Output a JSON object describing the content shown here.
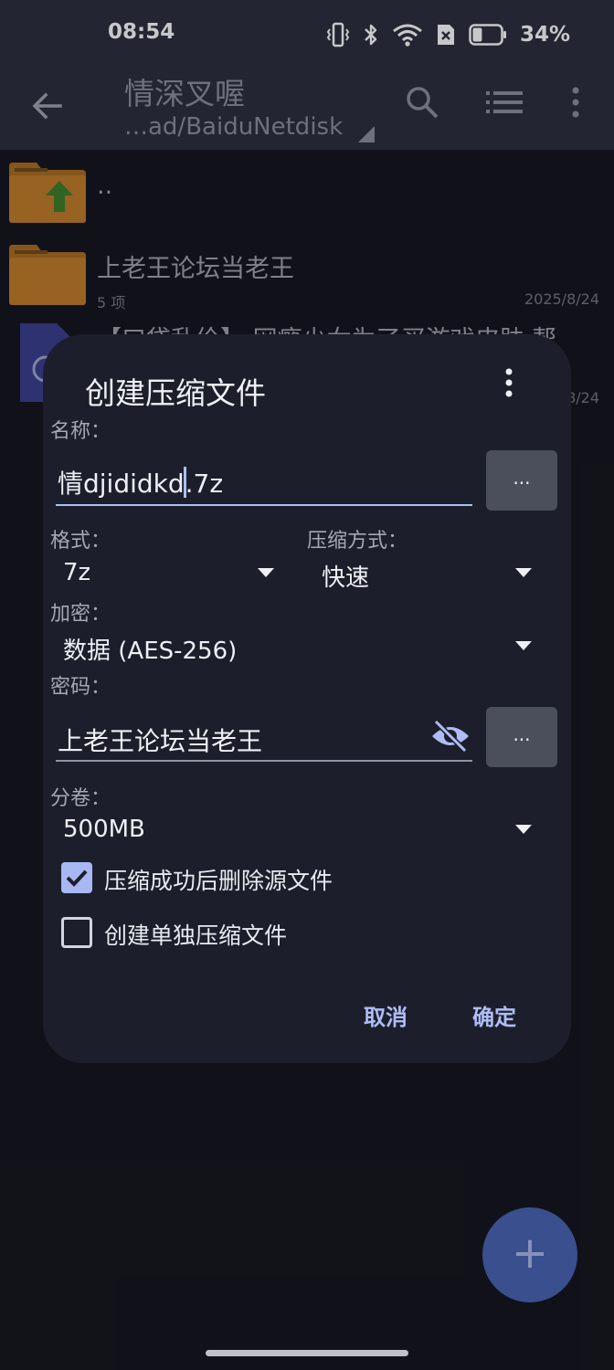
{
  "status_bar": {
    "time": "08:54",
    "battery_percent": "34%",
    "battery_level": 0.34,
    "icons": [
      "vibrate-icon",
      "bluetooth-icon",
      "wifi-icon",
      "no-sim-icon",
      "battery-icon"
    ]
  },
  "app_bar": {
    "title": "情深叉喔",
    "subtitle": "…ad/BaiduNetdisk"
  },
  "file_list": [
    {
      "name": "..",
      "meta": "",
      "date": ""
    },
    {
      "name": "上老王论坛当老王",
      "meta": "5 项",
      "date": "2025/8/24"
    },
    {
      "name": "【口袋乱伦】 网瘾少女为了买游戏皮肤 帮",
      "meta": "",
      "date": "8/24"
    }
  ],
  "dialog": {
    "title": "创建压缩文件",
    "name_label": "名称：",
    "name_value_before_cursor": "情djididkd",
    "name_value_after_cursor": ".7z",
    "browse_label": "...",
    "format_label": "格式：",
    "format_value": "7z",
    "compression_label": "压缩方式：",
    "compression_value": "快速",
    "encryption_label": "加密：",
    "encryption_value": "数据 (AES-256)",
    "password_label": "密码：",
    "password_value": "上老王论坛当老王",
    "split_label": "分卷：",
    "split_value": "500MB",
    "delete_source_label": "压缩成功后删除源文件",
    "delete_source_checked": true,
    "separate_archives_label": "创建单独压缩文件",
    "separate_archives_checked": false,
    "cancel_label": "取消",
    "ok_label": "确定"
  },
  "fab": {
    "label": "+"
  },
  "colors": {
    "accent": "#aebdf6",
    "dialog_bg": "#1c1f2b",
    "appbar_bg": "#2b2f3d",
    "folder": "#b9782a",
    "fab": "#3a4f8d"
  }
}
